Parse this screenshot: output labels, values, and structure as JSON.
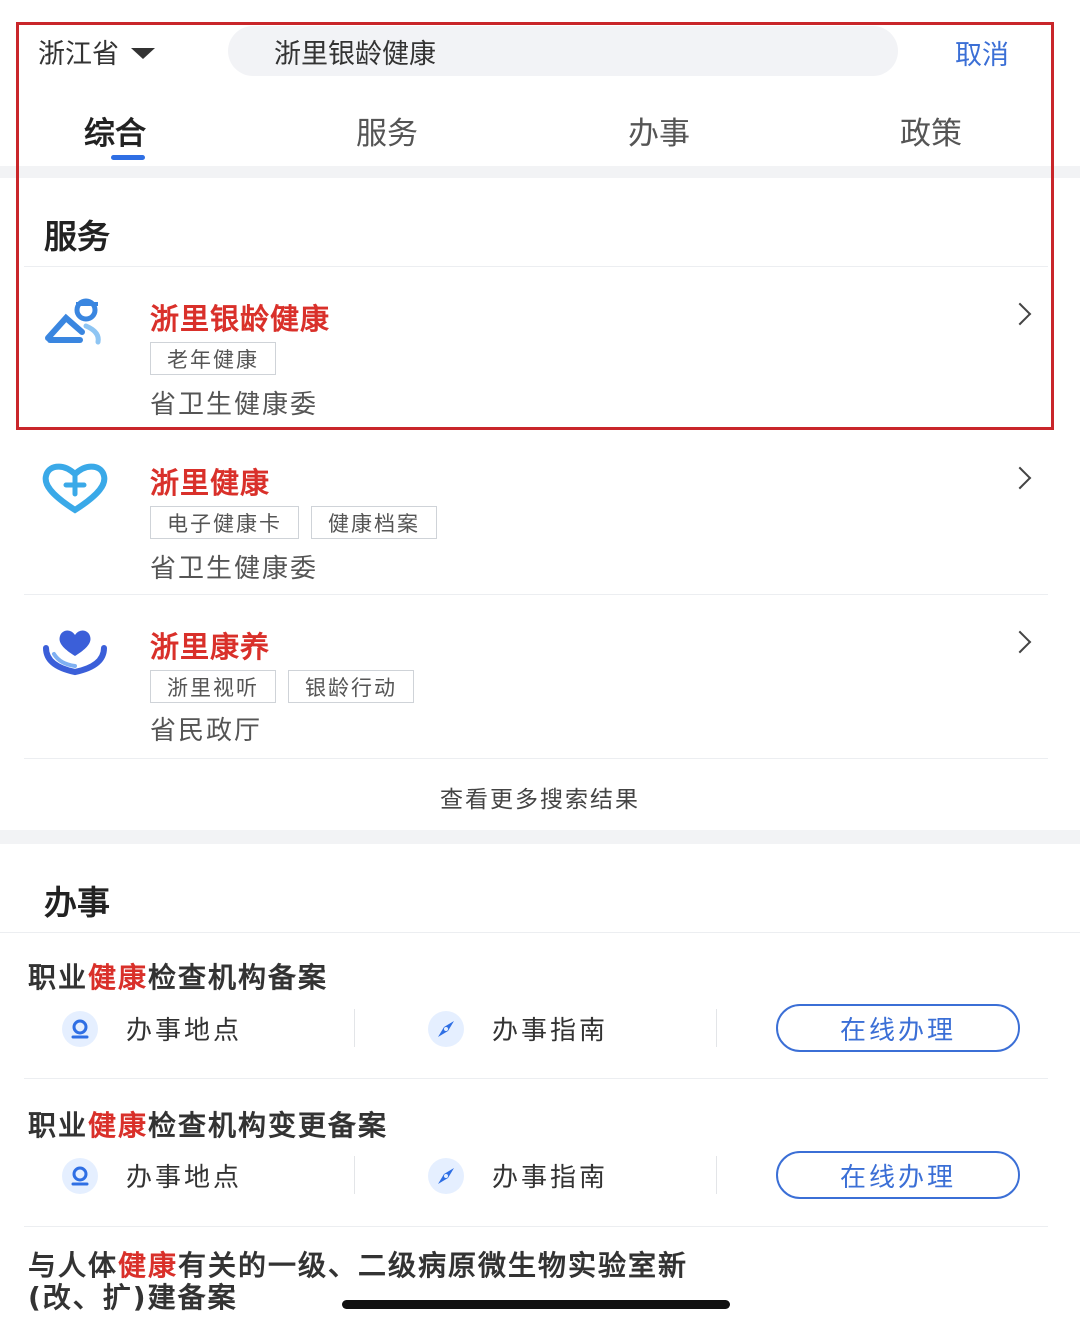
{
  "header": {
    "province": "浙江省",
    "search_value": "浙里银龄健康",
    "cancel_label": "取消"
  },
  "tabs": [
    "综合",
    "服务",
    "办事",
    "政策"
  ],
  "services_section": {
    "title": "服务",
    "items": [
      {
        "name": "浙里银龄健康",
        "tags": [
          "老年健康"
        ],
        "dept": "省卫生健康委",
        "icon": "elder-care-icon"
      },
      {
        "name": "浙里健康",
        "tags": [
          "电子健康卡",
          "健康档案"
        ],
        "dept": "省卫生健康委",
        "icon": "heart-plus-icon"
      },
      {
        "name": "浙里康养",
        "tags": [
          "浙里视听",
          "银龄行动"
        ],
        "dept": "省民政厅",
        "icon": "heart-hands-icon"
      }
    ],
    "more_label": "查看更多搜索结果"
  },
  "affairs_section": {
    "title": "办事",
    "items": [
      {
        "pre": "职业",
        "hl": "健康",
        "post": "检查机构备案"
      },
      {
        "pre": "职业",
        "hl": "健康",
        "post": "检查机构变更备案"
      },
      {
        "pre": "与人体",
        "hl": "健康",
        "post": "有关的一级、二级病原微生物实验室新",
        "line2": "(改、扩)建备案"
      }
    ],
    "location_label": "办事地点",
    "guide_label": "办事指南",
    "online_label": "在线办理"
  },
  "colors": {
    "accent": "#3b6fd6",
    "highlight": "#d9302a",
    "frame": "#c9262a"
  }
}
